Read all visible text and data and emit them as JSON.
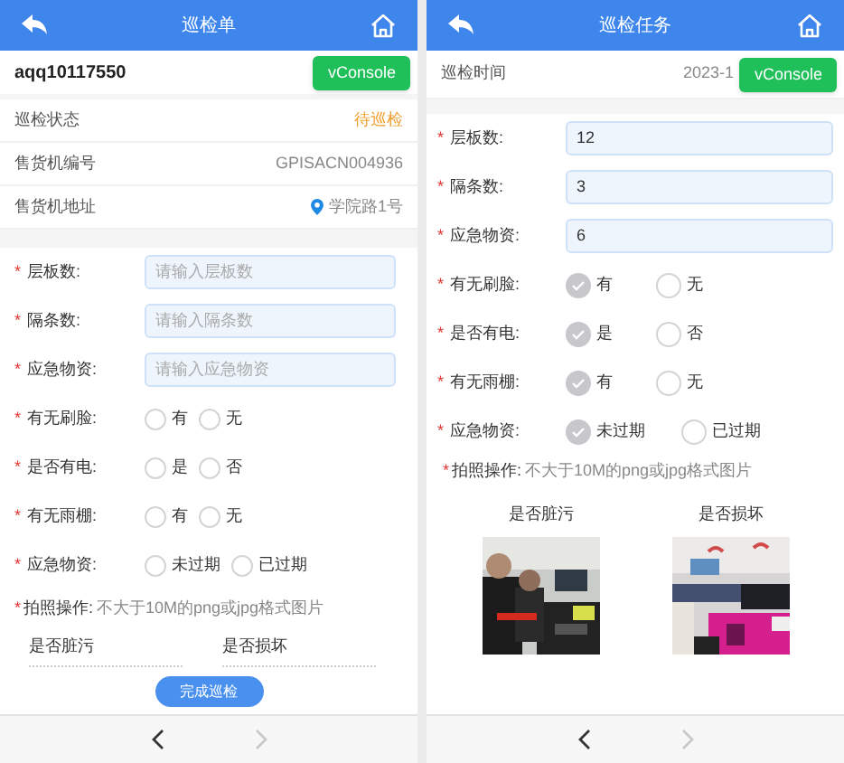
{
  "screens": [
    {
      "title": "巡检单",
      "order_id": "aqq10117550",
      "console_button": "vConsole",
      "info_rows": [
        {
          "label": "巡检状态",
          "value": "待巡检",
          "kind": "status"
        },
        {
          "label": "售货机编号",
          "value": "GPISACN004936",
          "kind": "text"
        },
        {
          "label": "售货机地址",
          "value": "学院路1号",
          "kind": "location"
        }
      ],
      "fields": [
        {
          "kind": "input",
          "mark": "*",
          "label": "层板数:",
          "placeholder": "请输入层板数"
        },
        {
          "kind": "input",
          "mark": "*",
          "label": "隔条数:",
          "placeholder": "请输入隔条数"
        },
        {
          "kind": "input",
          "mark": "*",
          "label": "应急物资:",
          "placeholder": "请输入应急物资"
        },
        {
          "kind": "radio",
          "mark": "*",
          "label": "有无刷脸:",
          "options": [
            {
              "label": "有",
              "selected": false
            },
            {
              "label": "无",
              "selected": false
            }
          ]
        },
        {
          "kind": "radio",
          "mark": "*",
          "label": "是否有电:",
          "options": [
            {
              "label": "是",
              "selected": false
            },
            {
              "label": "否",
              "selected": false
            }
          ]
        },
        {
          "kind": "radio",
          "mark": "*",
          "label": "有无雨棚:",
          "options": [
            {
              "label": "有",
              "selected": false
            },
            {
              "label": "无",
              "selected": false
            }
          ]
        },
        {
          "kind": "radio",
          "mark": "*",
          "label": "应急物资:",
          "options": [
            {
              "label": "未过期",
              "selected": false
            },
            {
              "label": "已过期",
              "selected": false
            }
          ]
        }
      ],
      "photo_mark": "*",
      "photo_label": "拍照操作:",
      "photo_hint": "不大于10M的png或jpg格式图片",
      "photos": [
        {
          "label": "是否脏污"
        },
        {
          "label": "是否损坏"
        }
      ],
      "submit_button": "完成巡检"
    },
    {
      "title": "巡检任务",
      "console_button": "vConsole",
      "info_rows": [
        {
          "label": "巡检时间",
          "value": "2023-1",
          "kind": "text"
        }
      ],
      "fields": [
        {
          "kind": "input",
          "mark": "*",
          "label": "层板数:",
          "value": "12"
        },
        {
          "kind": "input",
          "mark": "*",
          "label": "隔条数:",
          "value": "3"
        },
        {
          "kind": "input",
          "mark": "*",
          "label": "应急物资:",
          "value": "6"
        },
        {
          "kind": "radio",
          "mark": "*",
          "label": "有无刷脸:",
          "options": [
            {
              "label": "有",
              "selected": true
            },
            {
              "label": "无",
              "selected": false
            }
          ]
        },
        {
          "kind": "radio",
          "mark": "*",
          "label": "是否有电:",
          "options": [
            {
              "label": "是",
              "selected": true
            },
            {
              "label": "否",
              "selected": false
            }
          ]
        },
        {
          "kind": "radio",
          "mark": "*",
          "label": "有无雨棚:",
          "options": [
            {
              "label": "有",
              "selected": true
            },
            {
              "label": "无",
              "selected": false
            }
          ]
        },
        {
          "kind": "radio",
          "mark": "*",
          "label": "应急物资:",
          "options": [
            {
              "label": "未过期",
              "selected": true
            },
            {
              "label": "已过期",
              "selected": false
            }
          ]
        }
      ],
      "photo_mark": "*",
      "photo_label": "拍照操作:",
      "photo_hint": "不大于10M的png或jpg格式图片",
      "photos": [
        {
          "label": "是否脏污",
          "kind": "picture"
        },
        {
          "label": "是否损坏",
          "kind": "picture"
        }
      ]
    }
  ]
}
